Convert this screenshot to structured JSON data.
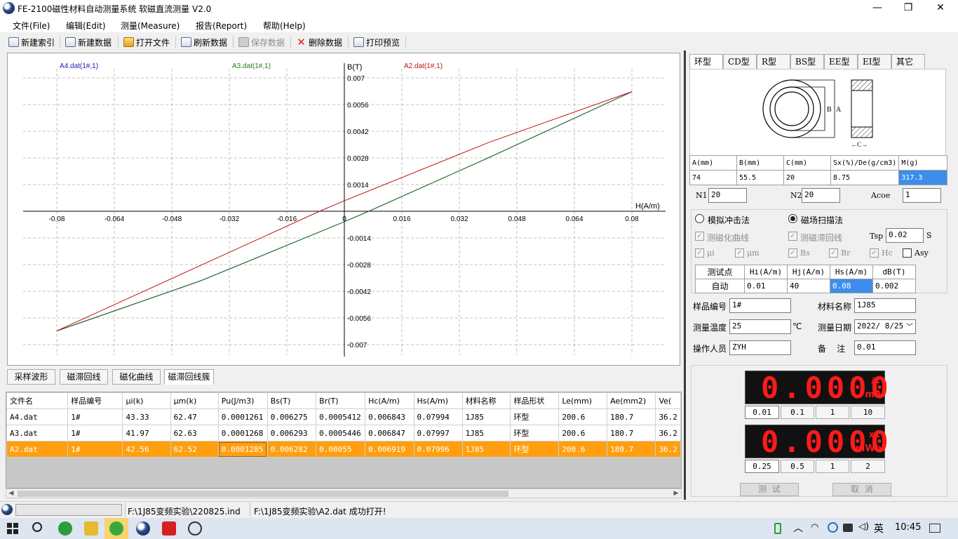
{
  "window": {
    "title": "FE-2100磁性材料自动测量系统 软磁直流测量 V2.0",
    "minimize": "—",
    "restore": "❐",
    "close": "✕"
  },
  "menu": [
    "文件(File)",
    "编辑(Edit)",
    "测量(Measure)",
    "报告(Report)",
    "帮助(Help)"
  ],
  "toolbar": {
    "new_index": "新建索引",
    "new_data": "新建数据",
    "open_file": "打开文件",
    "refresh_data": "刷新数据",
    "save_data": "保存数据",
    "delete_data": "删除数据",
    "print_preview": "打印预览"
  },
  "chart_data": {
    "type": "line",
    "title": "",
    "xlabel": "H(A/m)",
    "ylabel": "B(T)",
    "xlim": [
      -0.08,
      0.08
    ],
    "ylim": [
      -0.007,
      0.007
    ],
    "xticks": [
      "-0.08",
      "-0.064",
      "-0.048",
      "-0.032",
      "-0.016",
      "0",
      "0.016",
      "0.032",
      "0.048",
      "0.064",
      "0.08"
    ],
    "yticks": [
      "0.007",
      "0.0056",
      "0.0042",
      "0.0028",
      "0.0014",
      "-0.0014",
      "-0.0028",
      "-0.0042",
      "-0.0056",
      "-0.007"
    ],
    "grid": true,
    "legend_placement": "top",
    "series": [
      {
        "name": "A4.dat(1#,1)",
        "color": "#1a1aa8",
        "x": [
          -0.08,
          -0.04,
          0.0,
          0.0068,
          0.04,
          0.08
        ],
        "y": [
          -0.00628,
          -0.00365,
          -0.00055,
          0.0,
          0.0028,
          0.00627
        ]
      },
      {
        "name": "A3.dat(1#,1)",
        "color": "#2a7a1a",
        "x": [
          -0.08,
          -0.04,
          0.0,
          0.0068,
          0.04,
          0.08
        ],
        "y": [
          -0.00629,
          -0.00366,
          -0.00055,
          0.0,
          0.0028,
          0.00628
        ]
      },
      {
        "name": "A2.dat(1#,1)",
        "color": "#c01010",
        "x": [
          -0.08,
          -0.0069,
          0.0,
          0.04,
          0.08
        ],
        "y": [
          -0.00628,
          0.0,
          0.00055,
          0.0036,
          0.00628
        ]
      }
    ]
  },
  "bottom_tabs": [
    "采样波形",
    "磁滞回线",
    "磁化曲线",
    "磁滞回线簇"
  ],
  "grid": {
    "columns": [
      "文件名",
      "样品编号",
      "μi(k)",
      "μm(k)",
      "Pu(J/m3)",
      "Bs(T)",
      "Br(T)",
      "Hc(A/m)",
      "Hs(A/m)",
      "材料名称",
      "样品形状",
      "Le(mm)",
      "Ae(mm2)",
      "Ve("
    ],
    "rows": [
      [
        "A4.dat",
        "1#",
        "43.33",
        "62.47",
        "0.0001261",
        "0.006275",
        "0.0005412",
        "0.006843",
        "0.07994",
        "1J85",
        "环型",
        "200.6",
        "180.7",
        "36.2"
      ],
      [
        "A3.dat",
        "1#",
        "41.97",
        "62.63",
        "0.0001268",
        "0.006293",
        "0.0005446",
        "0.006847",
        "0.07997",
        "1J85",
        "环型",
        "200.6",
        "180.7",
        "36.2"
      ],
      [
        "A2.dat",
        "1#",
        "42.56",
        "62.52",
        "0.0001285",
        "0.006282",
        "0.00055",
        "0.006919",
        "0.07996",
        "1J85",
        "环型",
        "200.6",
        "180.7",
        "36.2"
      ]
    ]
  },
  "shape_tabs": [
    "环型",
    "CD型",
    "R型",
    "BS型",
    "EE型",
    "EI型",
    "其它"
  ],
  "shape_labels": {
    "b": "B",
    "a": "A",
    "c": "←C→"
  },
  "dims": {
    "headers": [
      "A(mm)",
      "B(mm)",
      "C(mm)",
      "Sx(%)/De(g/cm3)",
      "M(g)"
    ],
    "values": [
      "74",
      "55.5",
      "20",
      "8.75",
      "317.3"
    ]
  },
  "params": {
    "n1_label": "N1",
    "n1": "20",
    "n2_label": "N2",
    "n2": "20",
    "acoe_label": "Acoe",
    "acoe": "1"
  },
  "method": {
    "ballistic": "模拟冲击法",
    "sweep": "磁场扫描法",
    "mag_curve": "测磁化曲线",
    "hyst_loop": "测磁滞回线",
    "tsp_label": "Tsp",
    "tsp": "0.02",
    "tsp_unit": "S"
  },
  "checks": [
    "μi",
    "μm",
    "Bs",
    "Br",
    "Hc",
    "Asy"
  ],
  "points": {
    "headers": [
      "测试点",
      "Hi(A/m)",
      "Hj(A/m)",
      "Hs(A/m)",
      "dB(T)"
    ],
    "values": [
      "自动",
      "0.01",
      "40",
      "0.08",
      "0.002"
    ]
  },
  "sample": {
    "no_label": "样品编号",
    "no": "1#",
    "material_label": "材料名称",
    "material": "1J85",
    "temp_label": "测量温度",
    "temp": "25",
    "temp_unit": "℃",
    "date_label": "测量日期",
    "date": "2022/ 8/25",
    "operator_label": "操作人员",
    "operator": "ZYH",
    "note_label": "备    注",
    "note": "0.01"
  },
  "meter1": {
    "digits": "0.0000",
    "scale": "/1",
    "unit": "mA",
    "ranges": [
      "0.01",
      "0.1",
      "1",
      "10"
    ]
  },
  "meter2": {
    "digits": "0.0000",
    "scale": "x1",
    "unit": "mWb",
    "ranges": [
      "0.25",
      "0.5",
      "1",
      "2"
    ]
  },
  "actions": {
    "test": "测  试",
    "cancel": "取  消"
  },
  "status": {
    "index_path": "F:\\1J85变频实验\\220825.ind",
    "message": "F:\\1J85变频实验\\A2.dat 成功打开!"
  },
  "taskbar": {
    "ime": "英",
    "time": "10:45"
  }
}
